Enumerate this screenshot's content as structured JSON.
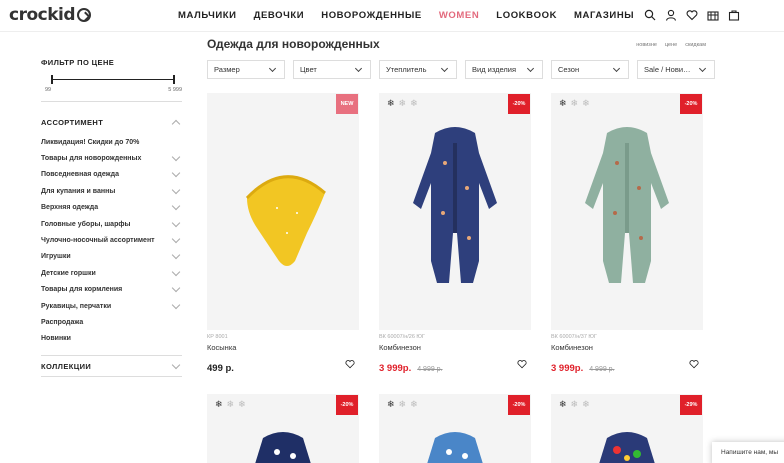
{
  "header": {
    "logo": "crockid",
    "nav": [
      "МАЛЬЧИКИ",
      "ДЕВОЧКИ",
      "НОВОРОЖДЕННЫЕ",
      "WOMEN",
      "LOOKBOOK",
      "МАГАЗИНЫ"
    ],
    "nav_accent_color": "#e36a7d",
    "icons": [
      "search-icon",
      "user-icon",
      "heart-icon",
      "compare-icon",
      "bag-icon"
    ]
  },
  "sidebar": {
    "price_filter": {
      "title": "ФИЛЬТР ПО ЦЕНЕ",
      "min": "99",
      "max": "5 999"
    },
    "assortment": {
      "title": "АССОРТИМЕНТ",
      "items": [
        "Ликвидация! Скидки до 70%",
        "Товары для новорожденных",
        "Повседневная одежда",
        "Для купания и ванны",
        "Верхняя одежда",
        "Головные уборы, шарфы",
        "Чулочно-носочный ассортимент",
        "Игрушки",
        "Детские горшки",
        "Товары для кормления",
        "Рукавицы, перчатки",
        "Распродажа",
        "Новинки"
      ]
    },
    "collections": "КОЛЛЕКЦИИ"
  },
  "main": {
    "title": "Одежда для новорожденных",
    "sort_links": [
      "новизне",
      "цене",
      "скидкам"
    ],
    "filters": [
      "Размер",
      "Цвет",
      "Утеплитель",
      "Вид изделия",
      "Сезон",
      "Sale / Нови…"
    ],
    "products": [
      {
        "badge": "NEW",
        "badge_color": "#e8707f",
        "sku": "КР 8001",
        "name": "Косынка",
        "price": "499 р.",
        "old_price": "",
        "snowflakes": 0
      },
      {
        "badge": "-20%",
        "badge_color": "#e0202a",
        "sku": "ВК 60007/н/26 ЮГ",
        "name": "Комбинезон",
        "price": "3 999р.",
        "old_price": "4 999 р.",
        "snowflakes": 1
      },
      {
        "badge": "-20%",
        "badge_color": "#e0202a",
        "sku": "ВК 60007/н/37 ЮГ",
        "name": "Комбинезон",
        "price": "3 999р.",
        "old_price": "4 999 р.",
        "snowflakes": 1
      }
    ],
    "second_row_badges": [
      "-20%",
      "-20%",
      "-29%"
    ]
  },
  "chat": "Напишите нам, мы"
}
